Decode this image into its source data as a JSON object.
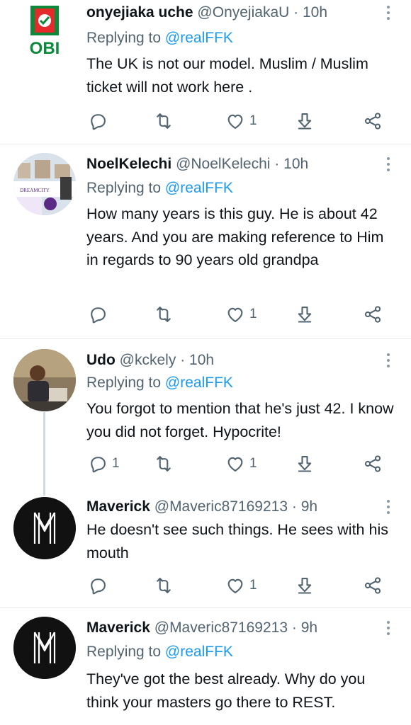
{
  "colors": {
    "accent": "#1d9bf0",
    "text": "#0f1419",
    "muted": "#536471"
  },
  "tweets": [
    {
      "name": "onyejiaka uche",
      "handle": "@OnyejiakaU",
      "sep": "·",
      "time": "10h",
      "replying_prefix": "Replying to",
      "replying_to": "@realFFK",
      "text": "The UK is not our model. Muslim / Muslim ticket will not work here .",
      "reply_count": "",
      "retweet_count": "",
      "like_count": "1",
      "avatar_label": "OBI"
    },
    {
      "name": "NoelKelechi",
      "handle": "@NoelKelechi",
      "sep": "·",
      "time": "10h",
      "replying_prefix": "Replying to",
      "replying_to": "@realFFK",
      "text": "How many years is this guy. He is about 42 years. And you are making reference to Him in regards to 90 years old grandpa",
      "reply_count": "",
      "retweet_count": "",
      "like_count": "1",
      "avatar_label": "DREAMCITY"
    },
    {
      "name": "Udo",
      "handle": "@kckely",
      "sep": "·",
      "time": "10h",
      "replying_prefix": "Replying to",
      "replying_to": "@realFFK",
      "text": "You forgot to mention that he's just 42. I know you did not forget. Hypocrite!",
      "reply_count": "1",
      "retweet_count": "",
      "like_count": "1"
    },
    {
      "name": "Maverick",
      "handle": "@Maveric87169213",
      "sep": "·",
      "time": "9h",
      "text": "He doesn't see such things. He sees with his mouth",
      "reply_count": "",
      "retweet_count": "",
      "like_count": "1"
    },
    {
      "name": "Maverick",
      "handle": "@Maveric87169213",
      "sep": "·",
      "time": "9h",
      "replying_prefix": "Replying to",
      "replying_to": "@realFFK",
      "text": "They've got the best already. Why do you think your masters go there to REST."
    }
  ]
}
